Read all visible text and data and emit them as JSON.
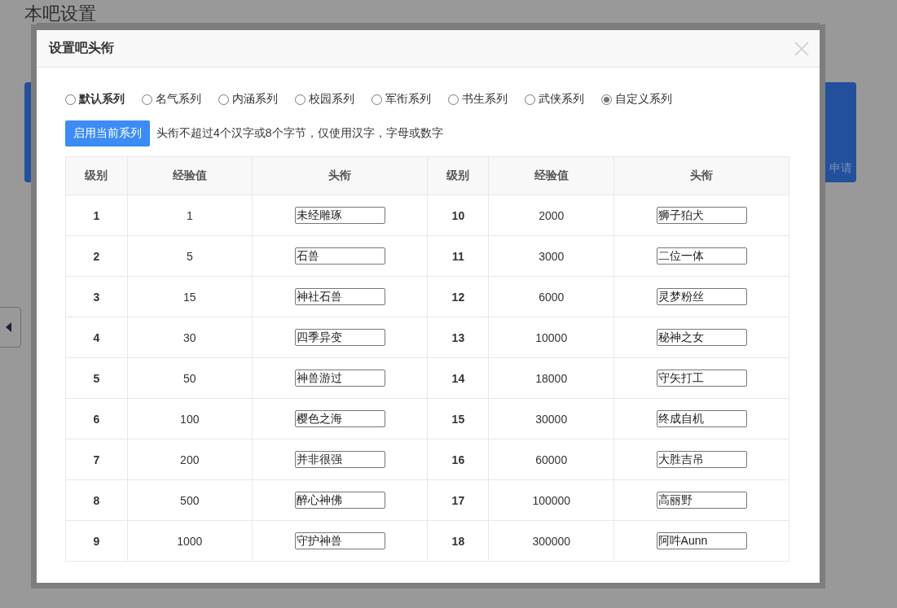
{
  "page": {
    "title": "本吧设置",
    "card_label": "申请"
  },
  "dialog": {
    "title": "设置吧头衔",
    "series": [
      {
        "label": "默认系列",
        "selected": false,
        "emphasized": true
      },
      {
        "label": "名气系列",
        "selected": false,
        "emphasized": false
      },
      {
        "label": "内涵系列",
        "selected": false,
        "emphasized": false
      },
      {
        "label": "校园系列",
        "selected": false,
        "emphasized": false
      },
      {
        "label": "军衔系列",
        "selected": false,
        "emphasized": false
      },
      {
        "label": "书生系列",
        "selected": false,
        "emphasized": false
      },
      {
        "label": "武侠系列",
        "selected": false,
        "emphasized": false
      },
      {
        "label": "自定义系列",
        "selected": true,
        "emphasized": false
      }
    ],
    "apply_button": "启用当前系列",
    "hint": "头衔不超过4个汉字或8个字节，仅使用汉字，字母或数字",
    "table": {
      "columns": [
        "级别",
        "经验值",
        "头衔",
        "级别",
        "经验值",
        "头衔"
      ],
      "rows": [
        [
          {
            "level": "1",
            "exp": "1",
            "title": "未经雕琢"
          },
          {
            "level": "10",
            "exp": "2000",
            "title": "狮子狛犬"
          }
        ],
        [
          {
            "level": "2",
            "exp": "5",
            "title": "石兽"
          },
          {
            "level": "11",
            "exp": "3000",
            "title": "二位一体"
          }
        ],
        [
          {
            "level": "3",
            "exp": "15",
            "title": "神社石兽"
          },
          {
            "level": "12",
            "exp": "6000",
            "title": "灵梦粉丝"
          }
        ],
        [
          {
            "level": "4",
            "exp": "30",
            "title": "四季异变"
          },
          {
            "level": "13",
            "exp": "10000",
            "title": "秘神之女"
          }
        ],
        [
          {
            "level": "5",
            "exp": "50",
            "title": "神兽游过"
          },
          {
            "level": "14",
            "exp": "18000",
            "title": "守矢打工"
          }
        ],
        [
          {
            "level": "6",
            "exp": "100",
            "title": "樱色之海"
          },
          {
            "level": "15",
            "exp": "30000",
            "title": "终成自机"
          }
        ],
        [
          {
            "level": "7",
            "exp": "200",
            "title": "并非很强"
          },
          {
            "level": "16",
            "exp": "60000",
            "title": "大胜吉吊"
          }
        ],
        [
          {
            "level": "8",
            "exp": "500",
            "title": "醉心神佛"
          },
          {
            "level": "17",
            "exp": "100000",
            "title": "高丽野"
          }
        ],
        [
          {
            "level": "9",
            "exp": "1000",
            "title": "守护神兽"
          },
          {
            "level": "18",
            "exp": "300000",
            "title": "阿吽Aunn"
          }
        ]
      ]
    }
  }
}
